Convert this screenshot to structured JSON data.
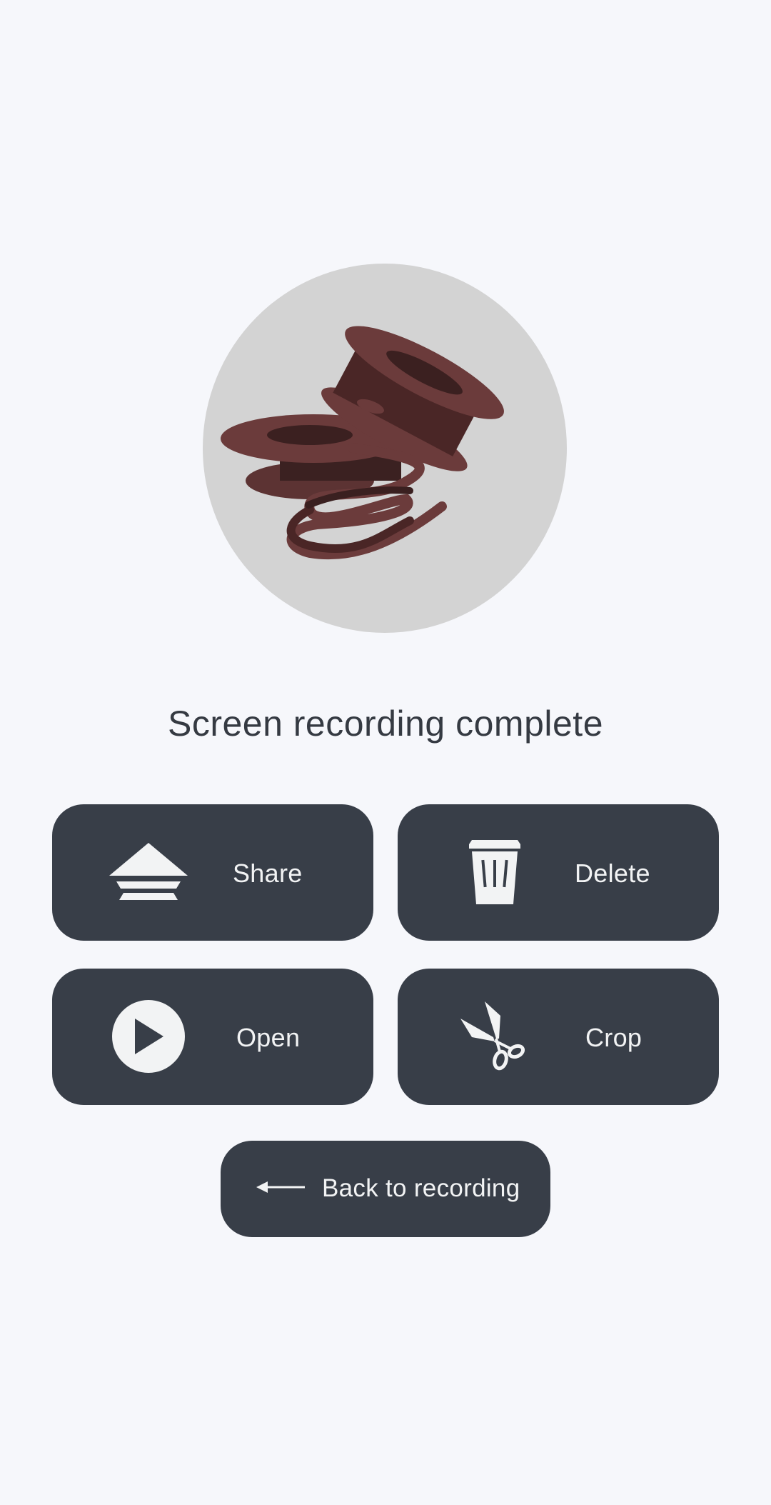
{
  "dialog": {
    "title": "Screen recording complete",
    "hero_icon": "film-reel-illustration"
  },
  "actions": {
    "share": {
      "label": "Share",
      "icon": "share-icon"
    },
    "delete": {
      "label": "Delete",
      "icon": "trash-icon"
    },
    "open": {
      "label": "Open",
      "icon": "play-icon"
    },
    "crop": {
      "label": "Crop",
      "icon": "scissors-icon"
    },
    "back": {
      "label": "Back to recording",
      "icon": "arrow-left-icon"
    }
  },
  "colors": {
    "background": "#f6f7fb",
    "button": "#383e48",
    "button_text": "#f2f3f4",
    "hero_circle": "#d3d3d3",
    "reel": "#6b3b3b",
    "reel_dark": "#3a2020"
  }
}
